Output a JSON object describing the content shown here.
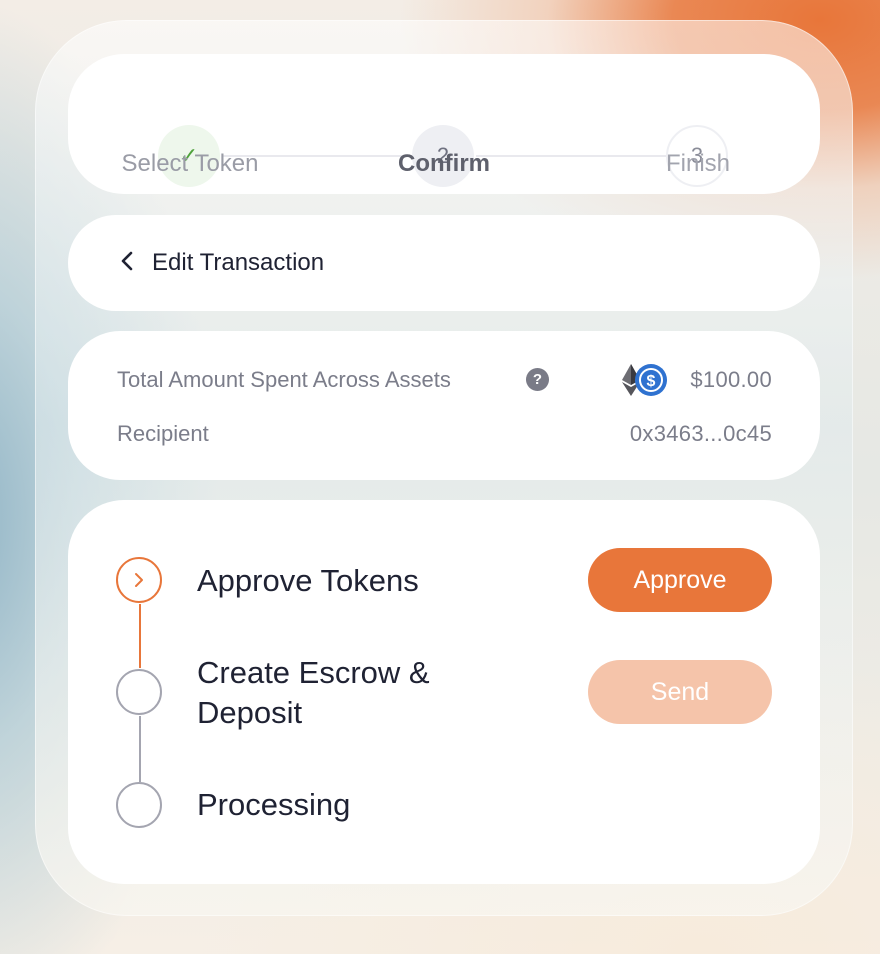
{
  "stepper": {
    "steps": [
      {
        "label": "Select Token",
        "marker": "✓",
        "state": "done"
      },
      {
        "label": "Confirm",
        "marker": "2",
        "state": "active"
      },
      {
        "label": "Finish",
        "marker": "3",
        "state": "upcoming"
      }
    ]
  },
  "edit": {
    "icon": "chevron-left-icon",
    "label": "Edit Transaction"
  },
  "summary": {
    "total_label": "Total Amount Spent Across Assets",
    "help_icon": "?",
    "token_icons": [
      "ethereum-icon",
      "usdc-icon"
    ],
    "total_value": "$100.00",
    "recipient_label": "Recipient",
    "recipient_value": "0x3463...0c45"
  },
  "tx_steps": [
    {
      "title": "Approve Tokens",
      "button": "Approve",
      "state": "current"
    },
    {
      "title_line1": "Create Escrow &",
      "title_line2": "Deposit",
      "button": "Send",
      "state": "pending"
    },
    {
      "title": "Processing",
      "state": "pending"
    }
  ],
  "colors": {
    "accent": "#e8763a",
    "accent_disabled": "#f5c4aa",
    "done_bg": "#eef7ec",
    "done_check": "#4fa23c",
    "active_bg": "#eeeff3",
    "text_dark": "#1f2233",
    "text_muted": "#7b7d8a"
  }
}
